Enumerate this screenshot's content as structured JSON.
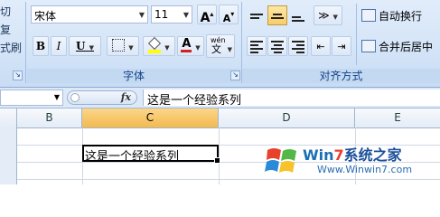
{
  "ribbon": {
    "clipboard_partial": [
      "切",
      "复",
      "式刷"
    ],
    "font": {
      "name": "宋体",
      "size": "11",
      "grow_label": "A",
      "shrink_label": "A",
      "bold": "B",
      "italic": "I",
      "underline": "U",
      "font_color_label": "A",
      "phonetic_label": "wén",
      "phonetic_char": "文",
      "group_label": "字体"
    },
    "alignment": {
      "wrap_text": "自动换行",
      "merge_center": "合并后居中",
      "group_label": "对齐方式"
    },
    "colors": {
      "font_color": "#d32020",
      "highlight": "#ffff00"
    }
  },
  "formula_bar": {
    "fx_label": "fx",
    "content": "这是一个经验系列"
  },
  "sheet": {
    "columns": [
      "B",
      "C",
      "D",
      "E"
    ],
    "selected_column": "C",
    "active_cell_text": "这是一个经验系列"
  },
  "watermark": {
    "brand_prefix": "Win",
    "brand_num": "7",
    "brand_suffix": "系统之家",
    "url": "Www.Winwin7.com"
  }
}
